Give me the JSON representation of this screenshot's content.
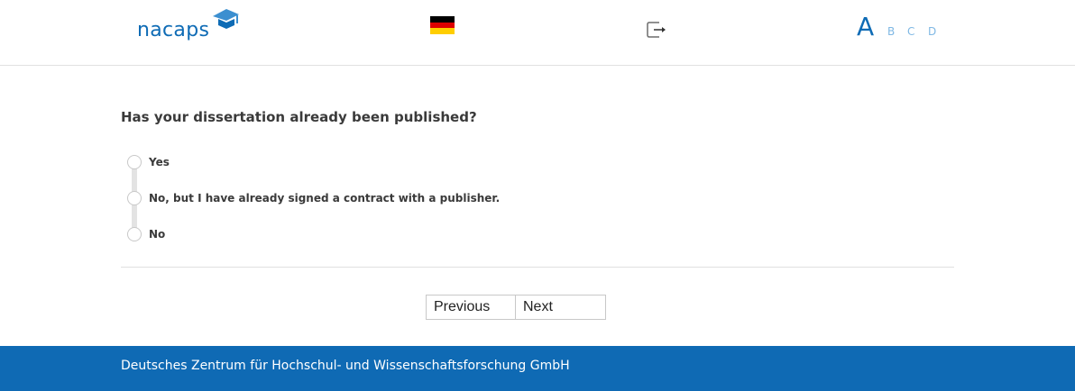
{
  "header": {
    "logo_text": "nacaps",
    "language_flag": "de-flag",
    "logout_icon": "logout-icon",
    "font_sizes": [
      "A",
      "B",
      "C",
      "D"
    ],
    "brand_color": "#0e6bb5"
  },
  "survey": {
    "question": "Has your dissertation already been published?",
    "options": [
      {
        "label": "Yes"
      },
      {
        "label": "No, but I have already signed a contract with a publisher."
      },
      {
        "label": "No"
      }
    ]
  },
  "navigation": {
    "previous_label": "Previous",
    "next_label": "Next"
  },
  "footer": {
    "text": "Deutsches Zentrum für Hochschul- und Wissenschaftsforschung GmbH",
    "background": "#0f6ab4"
  }
}
